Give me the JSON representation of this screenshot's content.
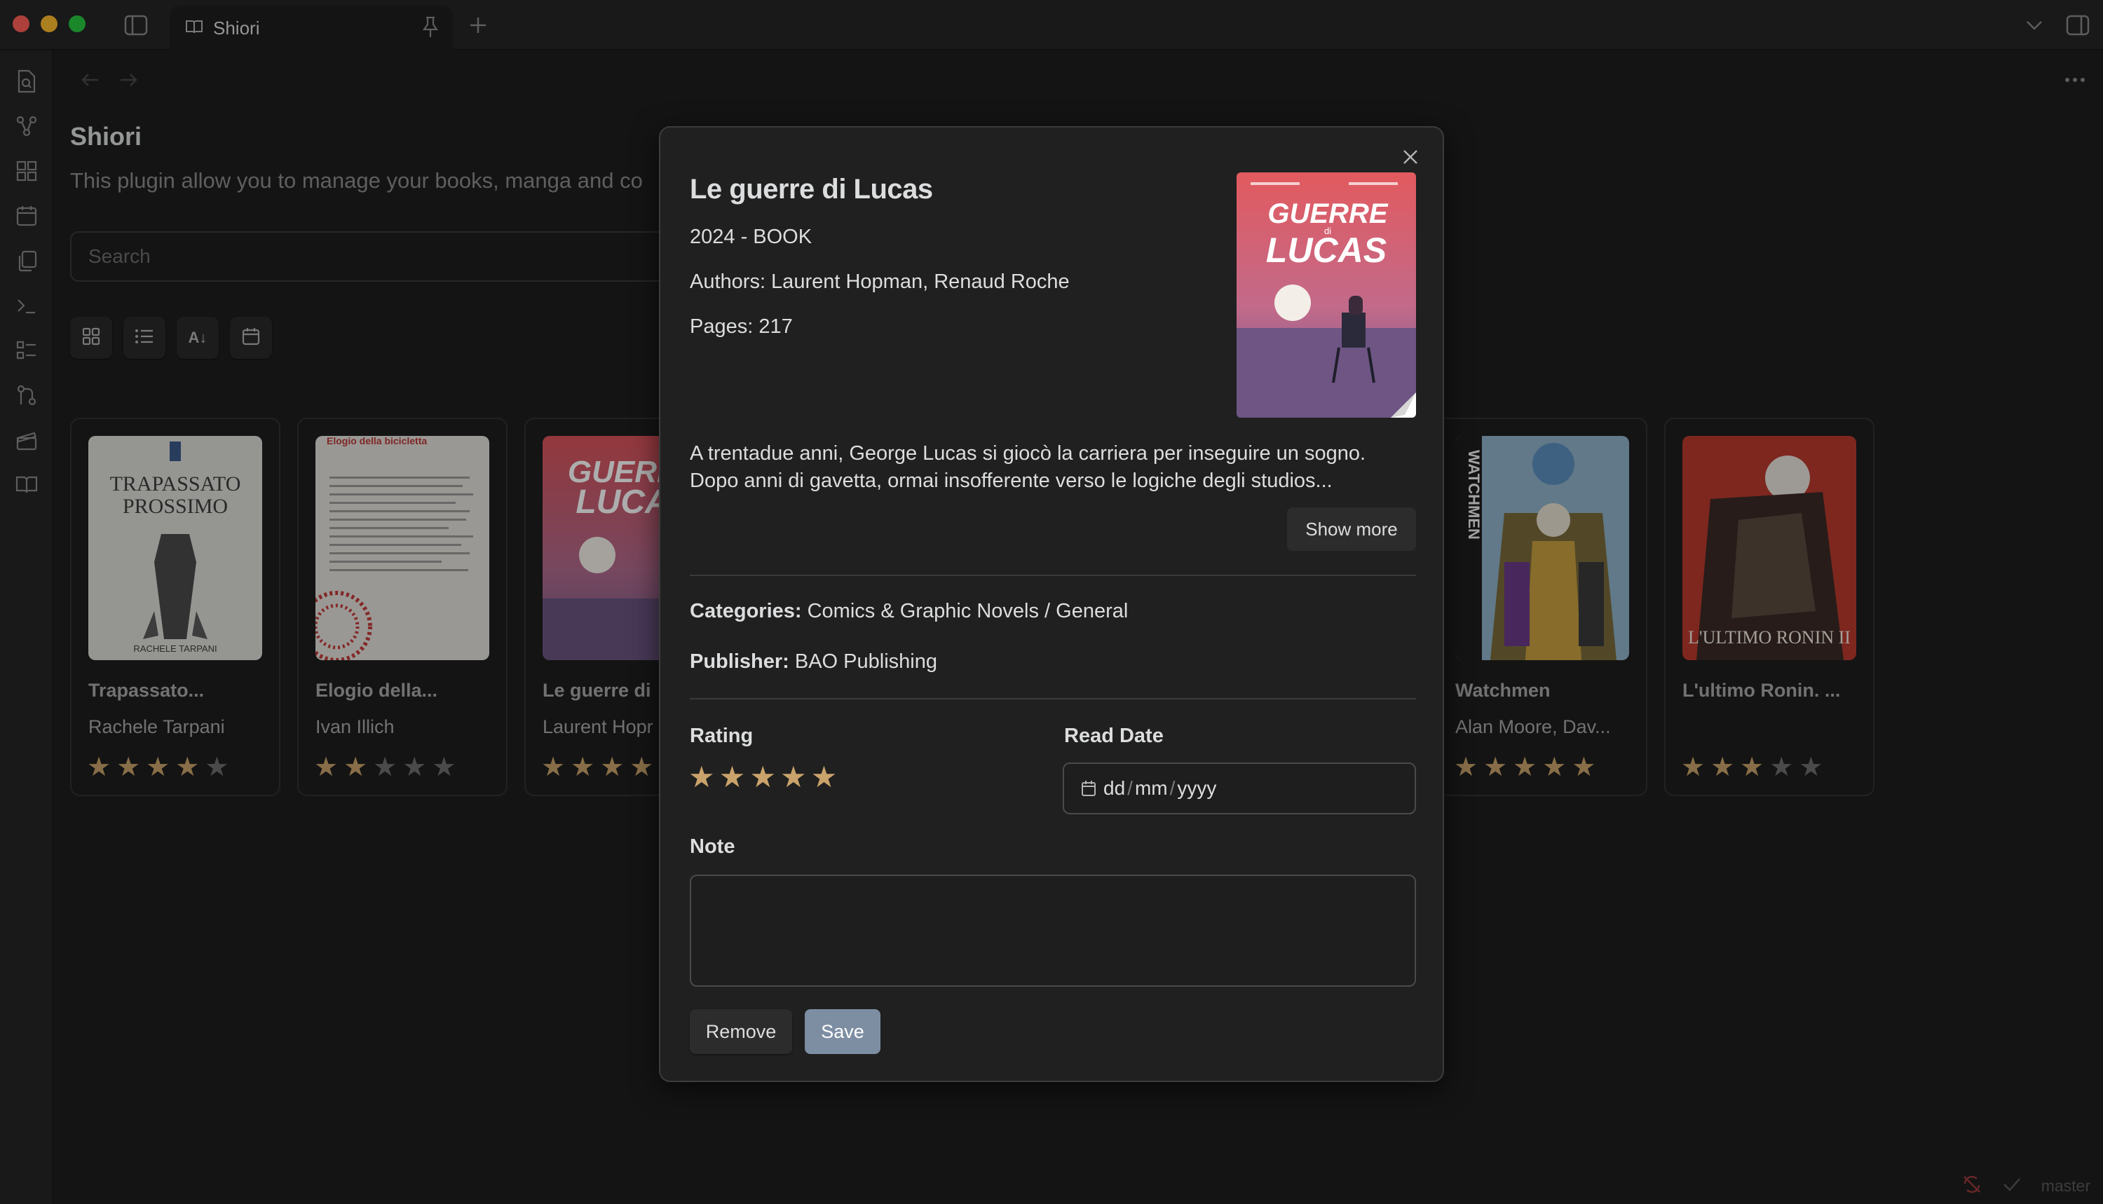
{
  "window": {
    "tab_title": "Shiori"
  },
  "page": {
    "title": "Shiori",
    "description": "This plugin allow you to manage your books, manga and co",
    "search_placeholder": "Search",
    "sort_icon_label": "A↓"
  },
  "colors": {
    "star_filled": "#c9a36b",
    "star_empty": "#6e6e6e",
    "save_button": "#7d8ea3"
  },
  "books": [
    {
      "title": "Trapassato...",
      "author": "Rachele Tarpani",
      "rating": 4,
      "cover_text": [
        "TRAPASSATO",
        "PROSSIMO",
        "RACHELE TARPANI"
      ]
    },
    {
      "title": "Elogio della...",
      "author": "Ivan Illich",
      "rating": 2,
      "cover_text": [
        "Elogio della bicicletta"
      ]
    },
    {
      "title": "Le guerre di",
      "author": "Laurent Hopr",
      "rating": 4,
      "cover_text": [
        "GUERRE",
        "LUCAS"
      ]
    },
    {
      "title": "Watchmen",
      "author": "Alan Moore, Dav...",
      "rating": 5,
      "cover_text": [
        "WATCHMEN"
      ]
    },
    {
      "title": "L'ultimo Ronin. ...",
      "author": "",
      "rating": 3,
      "cover_text": [
        "L'ULTIMO RONIN II"
      ]
    }
  ],
  "modal": {
    "title": "Le guerre di Lucas",
    "year_type": "2024 - BOOK",
    "authors": "Authors: Laurent Hopman, Renaud Roche",
    "pages": "Pages: 217",
    "cover_text": {
      "top": "GUERRE",
      "di": "di",
      "bottom": "LUCAS"
    },
    "description_line1": "A trentadue anni, George Lucas si giocò la carriera per inseguire un sogno.",
    "description_line2": "Dopo anni di gavetta, ormai insofferente verso le logiche degli studios...",
    "show_more_label": "Show more",
    "categories_label": "Categories:",
    "categories_value": "Comics & Graphic Novels / General",
    "publisher_label": "Publisher:",
    "publisher_value": "BAO Publishing",
    "rating_label": "Rating",
    "rating": 5,
    "read_date_label": "Read Date",
    "date_placeholder": {
      "dd": "dd",
      "mm": "mm",
      "yyyy": "yyyy"
    },
    "note_label": "Note",
    "note_value": "",
    "remove_label": "Remove",
    "save_label": "Save"
  },
  "statusbar": {
    "branch": "master"
  }
}
